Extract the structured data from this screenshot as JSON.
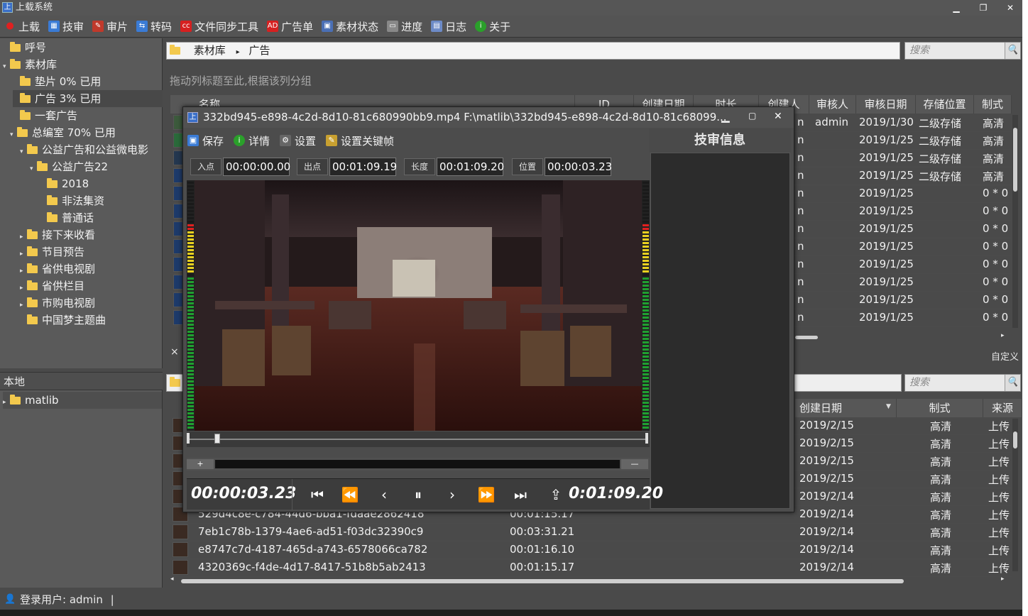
{
  "window": {
    "title": "上载系统",
    "app_icon": "上"
  },
  "toolbar": {
    "items": [
      {
        "label": "上载",
        "icon": "record-icon",
        "color": "#e02020"
      },
      {
        "label": "技审",
        "icon": "tech-review-icon",
        "color": "#3a7bd5"
      },
      {
        "label": "审片",
        "icon": "review-icon",
        "color": "#c0392b"
      },
      {
        "label": "转码",
        "icon": "transcode-icon",
        "color": "#3a7bd5"
      },
      {
        "label": "文件同步工具",
        "icon": "cc-icon",
        "color": "#d62020"
      },
      {
        "label": "广告单",
        "icon": "adv-icon",
        "color": "#d62020"
      },
      {
        "label": "素材状态",
        "icon": "material-status-icon",
        "color": "#4a6fb5"
      },
      {
        "label": "进度",
        "icon": "progress-icon",
        "color": "#888888"
      },
      {
        "label": "日志",
        "icon": "log-icon",
        "color": "#6d8bc7"
      },
      {
        "label": "关于",
        "icon": "info-icon",
        "color": "#2aa02a"
      }
    ]
  },
  "tree": {
    "nodes": [
      {
        "label": "呼号",
        "arrow": ""
      },
      {
        "label": "素材库",
        "arrow": "▾"
      },
      {
        "label": "垫片   0% 已用",
        "arrow": ""
      },
      {
        "label": "广告   3% 已用",
        "arrow": "",
        "selected": true
      },
      {
        "label": "一套广告",
        "arrow": ""
      },
      {
        "label": "总编室   70% 已用",
        "arrow": "▾"
      },
      {
        "label": "公益广告和公益微电影",
        "arrow": "▾"
      },
      {
        "label": "公益广告22",
        "arrow": "▾"
      },
      {
        "label": "2018",
        "arrow": ""
      },
      {
        "label": "非法集资",
        "arrow": ""
      },
      {
        "label": "普通话",
        "arrow": ""
      },
      {
        "label": "接下来收看",
        "arrow": "▸"
      },
      {
        "label": "节目预告",
        "arrow": "▸"
      },
      {
        "label": "省供电视剧",
        "arrow": "▸"
      },
      {
        "label": "省供栏目",
        "arrow": "▸"
      },
      {
        "label": "市购电视剧",
        "arrow": "▸"
      },
      {
        "label": "中国梦主题曲",
        "arrow": ""
      }
    ]
  },
  "local": {
    "header": "本地",
    "items": [
      {
        "label": "matlib",
        "arrow": "▸"
      }
    ]
  },
  "breadcrumb": {
    "root": "素材库",
    "separator": "▸",
    "current": "广告"
  },
  "search": {
    "placeholder": "搜索"
  },
  "grid1": {
    "group_hint": "拖动列标题至此,根据该列分组",
    "columns": [
      "名称",
      "ID",
      "创建日期",
      "时长",
      "创建人",
      "审核人",
      "审核日期",
      "存储位置",
      "制式"
    ],
    "rows": [
      {
        "creator": "n",
        "reviewer": "admin",
        "date": "2019/1/30",
        "storage": "二级存储",
        "format": "高清"
      },
      {
        "creator": "n",
        "reviewer": "",
        "date": "2019/1/25",
        "storage": "二级存储",
        "format": "高清"
      },
      {
        "creator": "n",
        "reviewer": "",
        "date": "2019/1/25",
        "storage": "二级存储",
        "format": "高清"
      },
      {
        "creator": "n",
        "reviewer": "",
        "date": "2019/1/25",
        "storage": "二级存储",
        "format": "高清"
      },
      {
        "creator": "n",
        "reviewer": "",
        "date": "2019/1/25",
        "storage": "",
        "format": "0 * 0"
      },
      {
        "creator": "n",
        "reviewer": "",
        "date": "2019/1/25",
        "storage": "",
        "format": "0 * 0"
      },
      {
        "creator": "n",
        "reviewer": "",
        "date": "2019/1/25",
        "storage": "",
        "format": "0 * 0"
      },
      {
        "creator": "n",
        "reviewer": "",
        "date": "2019/1/25",
        "storage": "",
        "format": "0 * 0"
      },
      {
        "creator": "n",
        "reviewer": "",
        "date": "2019/1/25",
        "storage": "",
        "format": "0 * 0"
      },
      {
        "creator": "n",
        "reviewer": "",
        "date": "2019/1/25",
        "storage": "",
        "format": "0 * 0"
      },
      {
        "creator": "n",
        "reviewer": "",
        "date": "2019/1/25",
        "storage": "",
        "format": "0 * 0"
      },
      {
        "creator": "n",
        "reviewer": "",
        "date": "2019/1/25",
        "storage": "",
        "format": "0 * 0"
      }
    ],
    "filter_close": "×",
    "customize": "自定义"
  },
  "grid2": {
    "columns": [
      "创建日期",
      "制式",
      "来源"
    ],
    "rows": [
      {
        "name": "",
        "duration": "",
        "date": "2019/2/15",
        "format": "高清",
        "source": "上传"
      },
      {
        "name": "",
        "duration": "",
        "date": "2019/2/15",
        "format": "高清",
        "source": "上传"
      },
      {
        "name": "",
        "duration": "",
        "date": "2019/2/15",
        "format": "高清",
        "source": "上传"
      },
      {
        "name": "",
        "duration": "",
        "date": "2019/2/15",
        "format": "高清",
        "source": "上传"
      },
      {
        "name": "",
        "duration": "",
        "date": "2019/2/14",
        "format": "高清",
        "source": "上传"
      },
      {
        "name": "529d4c8e-c784-44d6-bba1-fdaae2862418",
        "duration": "00:01:15.17",
        "date": "2019/2/14",
        "format": "高清",
        "source": "上传"
      },
      {
        "name": "7eb1c78b-1379-4ae6-ad51-f03dc32390c9",
        "duration": "00:03:31.21",
        "date": "2019/2/14",
        "format": "高清",
        "source": "上传"
      },
      {
        "name": "e8747c7d-4187-465d-a743-6578066ca782",
        "duration": "00:01:16.10",
        "date": "2019/2/14",
        "format": "高清",
        "source": "上传"
      },
      {
        "name": "4320369c-f4de-4d17-8417-51b8b5ab2413",
        "duration": "00:01:15.17",
        "date": "2019/2/14",
        "format": "高清",
        "source": "上传"
      }
    ]
  },
  "player": {
    "title": "332bd945-e898-4c2d-8d10-81c680990bb9.mp4 F:\\matlib\\332bd945-e898-4c2d-8d10-81c68099...",
    "tools": [
      {
        "label": "保存",
        "icon": "save-icon"
      },
      {
        "label": "详情",
        "icon": "details-icon"
      },
      {
        "label": "设置",
        "icon": "settings-icon"
      },
      {
        "label": "设置关键帧",
        "icon": "keyframe-icon"
      }
    ],
    "in_label": "入点",
    "in_value": "00:00:00.00",
    "out_label": "出点",
    "out_value": "00:01:09.19",
    "length_label": "长度",
    "length_value": "00:01:09.20",
    "pos_label": "位置",
    "pos_value": "00:00:03.23",
    "info_title": "技审信息",
    "current_time": "00:00:03.23",
    "total_time": "0:01:09.20",
    "progress": 0.049,
    "zoom_minus": "+",
    "zoom_plus": "—"
  },
  "status": {
    "user_label": "登录用户:",
    "user": "admin",
    "sep": "|"
  }
}
